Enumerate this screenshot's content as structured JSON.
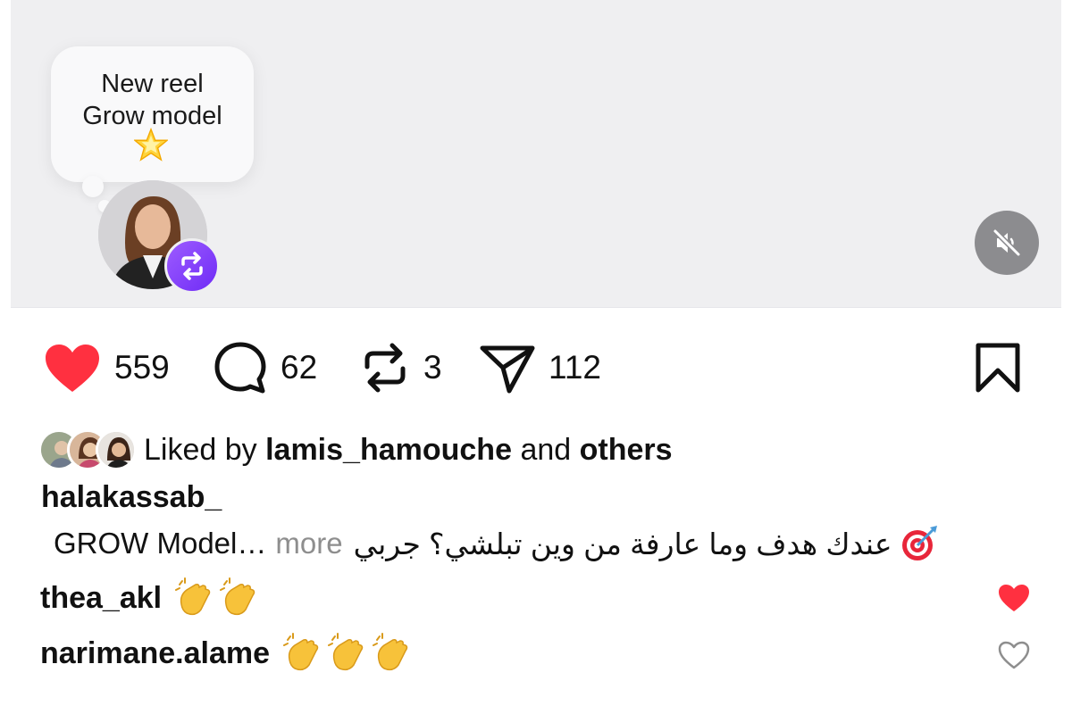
{
  "media": {
    "bubble_line1": "New reel",
    "bubble_line2": "Grow model",
    "icons": [
      "star-icon",
      "repost-icon",
      "mute-icon"
    ]
  },
  "actions": {
    "likes": "559",
    "comments": "62",
    "reposts": "3",
    "shares": "112",
    "like_color": "#ff3040"
  },
  "likes": {
    "prefix": "Liked by",
    "user": "lamis_hamouche",
    "middle": "and",
    "others": "others"
  },
  "post": {
    "username": "halakassab_",
    "caption_arabic": "عندك هدف وما عارفة من وين تبلشي؟ جربي",
    "caption_english": "GROW Model…",
    "more_label": "more"
  },
  "comments": [
    {
      "user": "thea_akl",
      "claps": 2,
      "liked": true
    },
    {
      "user": "narimane.alame",
      "claps": 3,
      "liked": false
    }
  ]
}
